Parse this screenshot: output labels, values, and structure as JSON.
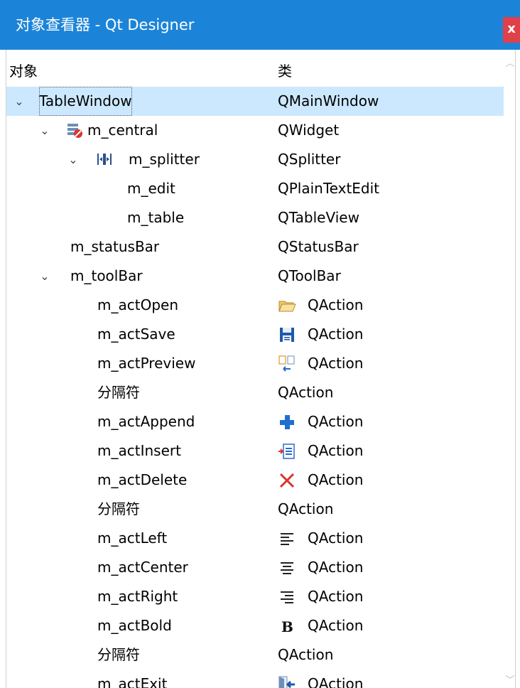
{
  "window": {
    "title": "对象查看器 - Qt Designer",
    "close_label": "x"
  },
  "header": {
    "col_object": "对象",
    "col_class": "类"
  },
  "rows": [
    {
      "name": "TableWindow",
      "cls": "QMainWindow",
      "expander": "⌄",
      "selected": true
    },
    {
      "name": "m_central",
      "cls": "QWidget",
      "expander": "⌄",
      "icon": "widget-icon"
    },
    {
      "name": "m_splitter",
      "cls": "QSplitter",
      "expander": "⌄",
      "icon": "splitter-icon"
    },
    {
      "name": "m_edit",
      "cls": "QPlainTextEdit"
    },
    {
      "name": "m_table",
      "cls": "QTableView"
    },
    {
      "name": "m_statusBar",
      "cls": "QStatusBar"
    },
    {
      "name": "m_toolBar",
      "cls": "QToolBar",
      "expander": "⌄"
    },
    {
      "name": "m_actOpen",
      "cls": "QAction",
      "cicon": "folder-open-icon"
    },
    {
      "name": "m_actSave",
      "cls": "QAction",
      "cicon": "save-disk-icon"
    },
    {
      "name": "m_actPreview",
      "cls": "QAction",
      "cicon": "preview-icon"
    },
    {
      "name": "分隔符",
      "cls": "QAction"
    },
    {
      "name": "m_actAppend",
      "cls": "QAction",
      "cicon": "plus-icon"
    },
    {
      "name": "m_actInsert",
      "cls": "QAction",
      "cicon": "insert-row-icon"
    },
    {
      "name": "m_actDelete",
      "cls": "QAction",
      "cicon": "delete-x-icon"
    },
    {
      "name": "分隔符",
      "cls": "QAction"
    },
    {
      "name": "m_actLeft",
      "cls": "QAction",
      "cicon": "align-left-icon"
    },
    {
      "name": "m_actCenter",
      "cls": "QAction",
      "cicon": "align-center-icon"
    },
    {
      "name": "m_actRight",
      "cls": "QAction",
      "cicon": "align-right-icon"
    },
    {
      "name": "m_actBold",
      "cls": "QAction",
      "cicon": "bold-icon"
    },
    {
      "name": "分隔符",
      "cls": "QAction"
    },
    {
      "name": "m_actExit",
      "cls": "QAction",
      "cicon": "exit-icon"
    }
  ],
  "colors": {
    "titlebar": "#1c84d8",
    "selection": "#cce8ff",
    "close": "#e0404a"
  }
}
